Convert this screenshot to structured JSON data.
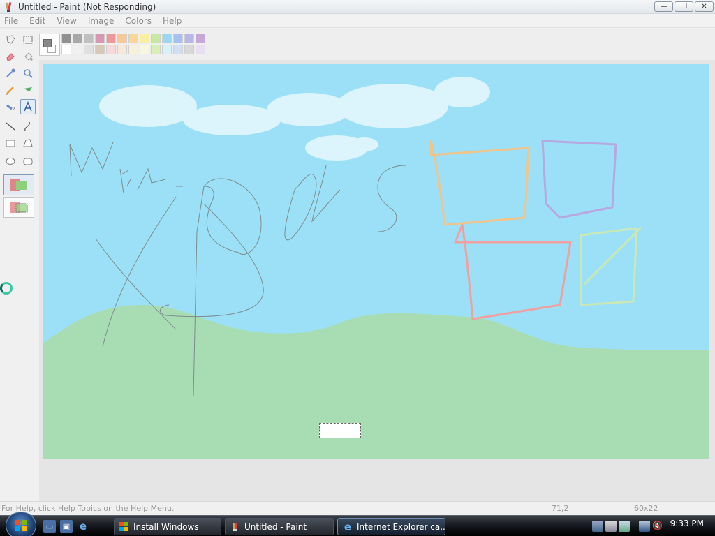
{
  "window": {
    "title": "Untitled - Paint (Not Responding)",
    "minimize": "—",
    "maximize": "❐",
    "close": "✕"
  },
  "menu": [
    "File",
    "Edit",
    "View",
    "Image",
    "Colors",
    "Help"
  ],
  "tools": [
    "free-form-select",
    "rect-select",
    "eraser",
    "fill",
    "color-picker",
    "magnifier",
    "pencil",
    "brush",
    "airbrush",
    "text",
    "line",
    "curve",
    "rectangle",
    "polygon",
    "ellipse",
    "rounded-rectangle"
  ],
  "active_tool": "text",
  "palette": {
    "foreground": "#888888",
    "background": "#ffffff",
    "row1": [
      "#909090",
      "#a8a8a8",
      "#c0c0c0",
      "#d898b0",
      "#f09898",
      "#f8c898",
      "#f8d898",
      "#f8f0a0",
      "#c8e8a0",
      "#98d8f0",
      "#a8c0f0",
      "#b8b8e8",
      "#c8a8d8"
    ],
    "row2": [
      "#ffffff",
      "#f0f0f0",
      "#e0e0e0",
      "#d8c8b8",
      "#f8d8d8",
      "#f8e8d8",
      "#f8f0d8",
      "#f8f8e0",
      "#d8f0b8",
      "#d8f0f8",
      "#d0e0f0",
      "#d8d8d8",
      "#e8e0f0"
    ]
  },
  "canvas": {
    "sky_color": "#9be0f6",
    "grass_color": "#a8ddb4",
    "selection_size": "60x22"
  },
  "status": {
    "help_text": "For Help, click Help Topics on the Help Menu.",
    "position": "71,2",
    "size": "60x22"
  },
  "taskbar": {
    "tasks": [
      {
        "label": "Install Windows",
        "icon": "windows-flag-icon"
      },
      {
        "label": "Untitled - Paint",
        "icon": "paint-icon"
      },
      {
        "label": "Internet Explorer ca...",
        "icon": "ie-icon"
      }
    ],
    "clock": "9:33 PM"
  }
}
